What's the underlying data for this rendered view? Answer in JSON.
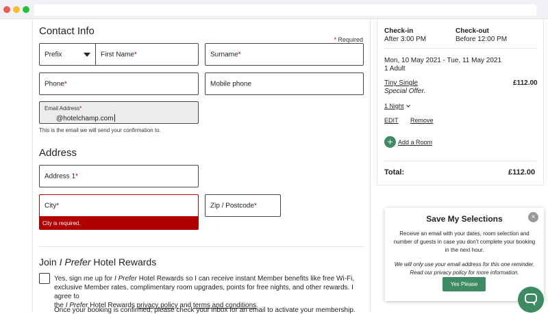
{
  "contact": {
    "heading": "Contact Info",
    "required_note": "Required",
    "prefix_label": "Prefix",
    "first_name": "First Name",
    "surname": "Surname",
    "phone": "Phone",
    "mobile": "Mobile phone",
    "email_label": "Email Address",
    "email_value": "@hotelchamp.com",
    "email_helper": "This is the email we will send your confirmation to."
  },
  "address": {
    "heading": "Address",
    "address1": "Address 1",
    "city": "City",
    "city_error": "City is required.",
    "zip": "Zip / Postcode"
  },
  "rewards": {
    "heading_pre": "Join ",
    "heading_brand": "I Prefer",
    "heading_post": " Hotel Rewards",
    "line1_pre": "Yes, sign me up for ",
    "line1_brand": "I Prefer",
    "line1_post": " Hotel Rewards so I can receive instant Member benefits like free Wi-Fi,",
    "line2": "exclusive Member rates, complimentary room upgrades, points for free nights, and other rewards. I agree to",
    "line3_pre": "the ",
    "line3_brand": "I Prefer",
    "line3_mid": " Hotel Rewards ",
    "privacy_link": "privacy policy",
    "and": " and ",
    "terms_link": "terms and conditions",
    "period": ".",
    "footer": "Once your booking is confirmed, please check your inbox for an email to activate your membership."
  },
  "summary": {
    "checkin_label": "Check-in",
    "checkin_value": "After 3:00 PM",
    "checkout_label": "Check-out",
    "checkout_value": "Before 12:00 PM",
    "dates": "Mon, 10 May 2021 - Tue, 11 May 2021",
    "guests": "1 Adult",
    "room_name": "Tiny Single",
    "room_offer": "Special Offer.",
    "room_price": "£112.00",
    "nights": "1 Night",
    "edit": "EDIT",
    "remove": "Remove",
    "add_room": "Add a Room",
    "total_label": "Total:",
    "total_value": "£112.00"
  },
  "popup": {
    "title": "Save My Selections",
    "body": "Receive an email with your dates, room selection and number of guests in case you don't complete your booking in the next hour.",
    "note": "We will only use your email address for this one reminder. Read our privacy policy for more information.",
    "button": "Yes Please",
    "close": "×"
  },
  "required_star": "*",
  "colors": {
    "accent": "#3d8a63",
    "error": "#b00000"
  },
  "icons": {
    "chat": "chat-icon",
    "close": "close-icon",
    "plus": "plus-icon"
  }
}
